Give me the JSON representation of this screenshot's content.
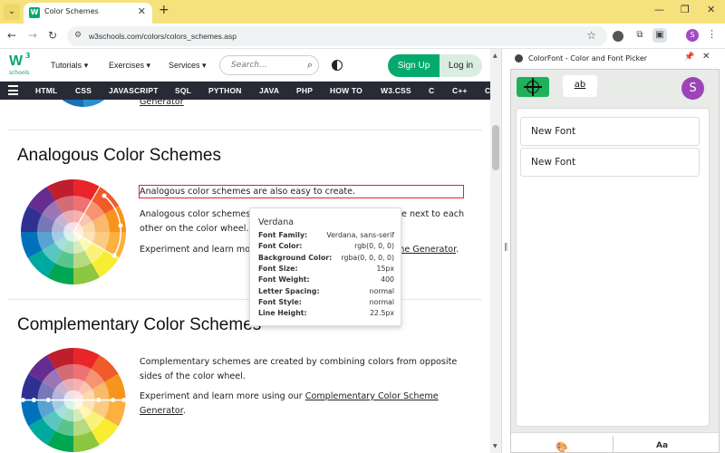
{
  "browser": {
    "tab_title": "Color Schemes",
    "tab_favicon": "W",
    "url": "w3schools.com/colors/colors_schemes.asp",
    "profile_initial": "S"
  },
  "w3": {
    "logo_main": "W",
    "logo_sup": "3",
    "logo_sub": "schools",
    "nav": [
      "Tutorials",
      "Exercises",
      "Services"
    ],
    "search_placeholder": "Search...",
    "signup_label": "Sign Up",
    "login_label": "Log in",
    "topnav": [
      "HTML",
      "CSS",
      "JAVASCRIPT",
      "SQL",
      "PYTHON",
      "JAVA",
      "PHP",
      "HOW TO",
      "W3.CSS",
      "C",
      "C++",
      "C"
    ]
  },
  "content": {
    "top_link": "Generator",
    "analogous": {
      "heading": "Analogous Color Schemes",
      "p1": "Analogous color schemes are also easy to create.",
      "p2_start": "Analogous color schemes",
      "p2_end": "e next to each",
      "p2_line2": "other on the color wheel.",
      "p3_start": "Experiment and learn mo",
      "p3_link": "me Generator",
      "p3_end": "."
    },
    "complementary": {
      "heading": "Complementary Color Schemes",
      "p1": "Complementary schemes are created by combining colors from opposite sides of the color wheel.",
      "p2_start": "Experiment and learn more using our ",
      "p2_link": "Complementary Color Scheme",
      "p2_link2": "Generator",
      "p2_end": "."
    }
  },
  "tooltip": {
    "title": "Verdana",
    "rows": [
      {
        "k": "Font Family:",
        "v": "Verdana, sans-serif"
      },
      {
        "k": "Font Color:",
        "v": "rgb(0, 0, 0)"
      },
      {
        "k": "Background Color:",
        "v": "rgba(0, 0, 0, 0)"
      },
      {
        "k": "Font Size:",
        "v": "15px"
      },
      {
        "k": "Font Weight:",
        "v": "400"
      },
      {
        "k": "Letter Spacing:",
        "v": "normal"
      },
      {
        "k": "Font Style:",
        "v": "normal"
      },
      {
        "k": "Line Height:",
        "v": "22.5px"
      }
    ]
  },
  "panel": {
    "title": "ColorFont - Color and Font Picker",
    "font_button": "ab",
    "avatar": "S",
    "items": [
      "New Font",
      "New Font"
    ],
    "footer_font": "Aa"
  }
}
